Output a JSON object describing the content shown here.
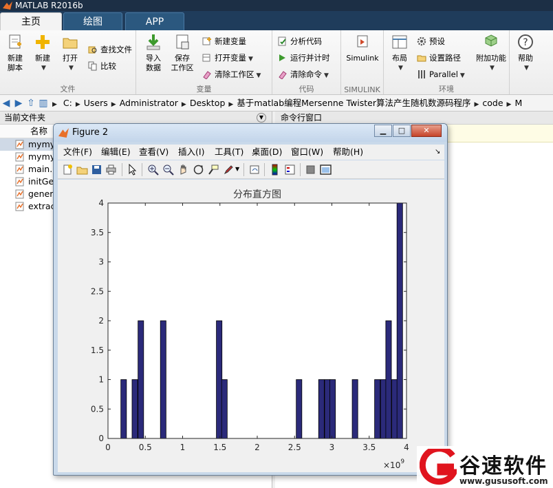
{
  "window": {
    "title": "MATLAB R2016b"
  },
  "tabs": [
    {
      "label": "主页"
    },
    {
      "label": "绘图"
    },
    {
      "label": "APP"
    }
  ],
  "ribbon": {
    "file_group": {
      "label": "文件",
      "new_script": "新建\n脚本",
      "new": "新建",
      "open": "打开",
      "find_files": "查找文件",
      "compare": "比较"
    },
    "variable_group": {
      "label": "变量",
      "import_data": "导入\n数据",
      "save_workspace": "保存\n工作区",
      "new_variable": "新建变量",
      "open_variable": "打开变量",
      "clear_workspace": "清除工作区"
    },
    "code_group": {
      "label": "代码",
      "analyze_code": "分析代码",
      "run_and_time": "运行并计时",
      "clear_commands": "清除命令"
    },
    "simulink_group": {
      "label": "SIMULINK",
      "simulink": "Simulink"
    },
    "environment_group": {
      "label": "环境",
      "layout": "布局",
      "preferences": "预设",
      "set_path": "设置路径",
      "parallel": "Parallel",
      "add_ons": "附加功能"
    },
    "resources_group": {
      "help": "帮助"
    }
  },
  "address": {
    "path": [
      "C:",
      "Users",
      "Administrator",
      "Desktop",
      "基于matlab编程Mersenne Twister算法产生随机数源码程序",
      "code",
      "M"
    ]
  },
  "left_panel": {
    "title": "当前文件夹",
    "column_name": "名称",
    "files": [
      {
        "name": "mymy",
        "selected": true
      },
      {
        "name": "mymy",
        "selected": false
      },
      {
        "name": "main.m",
        "selected": false
      },
      {
        "name": "initGe",
        "selected": false
      },
      {
        "name": "gener",
        "selected": false
      },
      {
        "name": "extrac",
        "selected": false
      }
    ]
  },
  "command_window": {
    "title": "命令行窗口"
  },
  "figure": {
    "title": "Figure 2",
    "menus": [
      "文件(F)",
      "编辑(E)",
      "查看(V)",
      "插入(I)",
      "工具(T)",
      "桌面(D)",
      "窗口(W)",
      "帮助(H)"
    ],
    "toolbar_icons": [
      "new-figure-icon",
      "open-file-icon",
      "save-icon",
      "print-icon",
      "pointer-icon",
      "zoom-in-icon",
      "zoom-out-icon",
      "pan-icon",
      "rotate-3d-icon",
      "data-cursor-icon",
      "brush-icon",
      "link-plot-icon",
      "colorbar-icon",
      "legend-icon",
      "hide-plot-tools-icon",
      "show-plot-tools-icon"
    ]
  },
  "chart_data": {
    "type": "bar",
    "title": "分布直方图",
    "xlabel": "",
    "ylabel": "",
    "x_exponent_label": "×10",
    "x_exponent_power": "9",
    "xlim": [
      0,
      4
    ],
    "ylim": [
      0,
      4
    ],
    "xticks": [
      "0",
      "0.5",
      "1",
      "1.5",
      "2",
      "2.5",
      "3",
      "3.5",
      "4"
    ],
    "yticks": [
      "0",
      "0.5",
      "1",
      "1.5",
      "2",
      "2.5",
      "3",
      "3.5",
      "4"
    ],
    "bar_width": 0.075,
    "bar_color": "#2b2a7a",
    "bars": [
      {
        "x": 0.21,
        "y": 1
      },
      {
        "x": 0.36,
        "y": 1
      },
      {
        "x": 0.44,
        "y": 2
      },
      {
        "x": 0.74,
        "y": 2
      },
      {
        "x": 1.49,
        "y": 2
      },
      {
        "x": 1.56,
        "y": 1
      },
      {
        "x": 2.56,
        "y": 1
      },
      {
        "x": 2.86,
        "y": 1
      },
      {
        "x": 2.94,
        "y": 1
      },
      {
        "x": 3.01,
        "y": 1
      },
      {
        "x": 3.31,
        "y": 1
      },
      {
        "x": 3.61,
        "y": 1
      },
      {
        "x": 3.69,
        "y": 1
      },
      {
        "x": 3.76,
        "y": 2
      },
      {
        "x": 3.84,
        "y": 1
      },
      {
        "x": 3.91,
        "y": 4
      }
    ]
  },
  "watermark": {
    "name": "谷速软件",
    "url": "www.gususoft.com"
  }
}
